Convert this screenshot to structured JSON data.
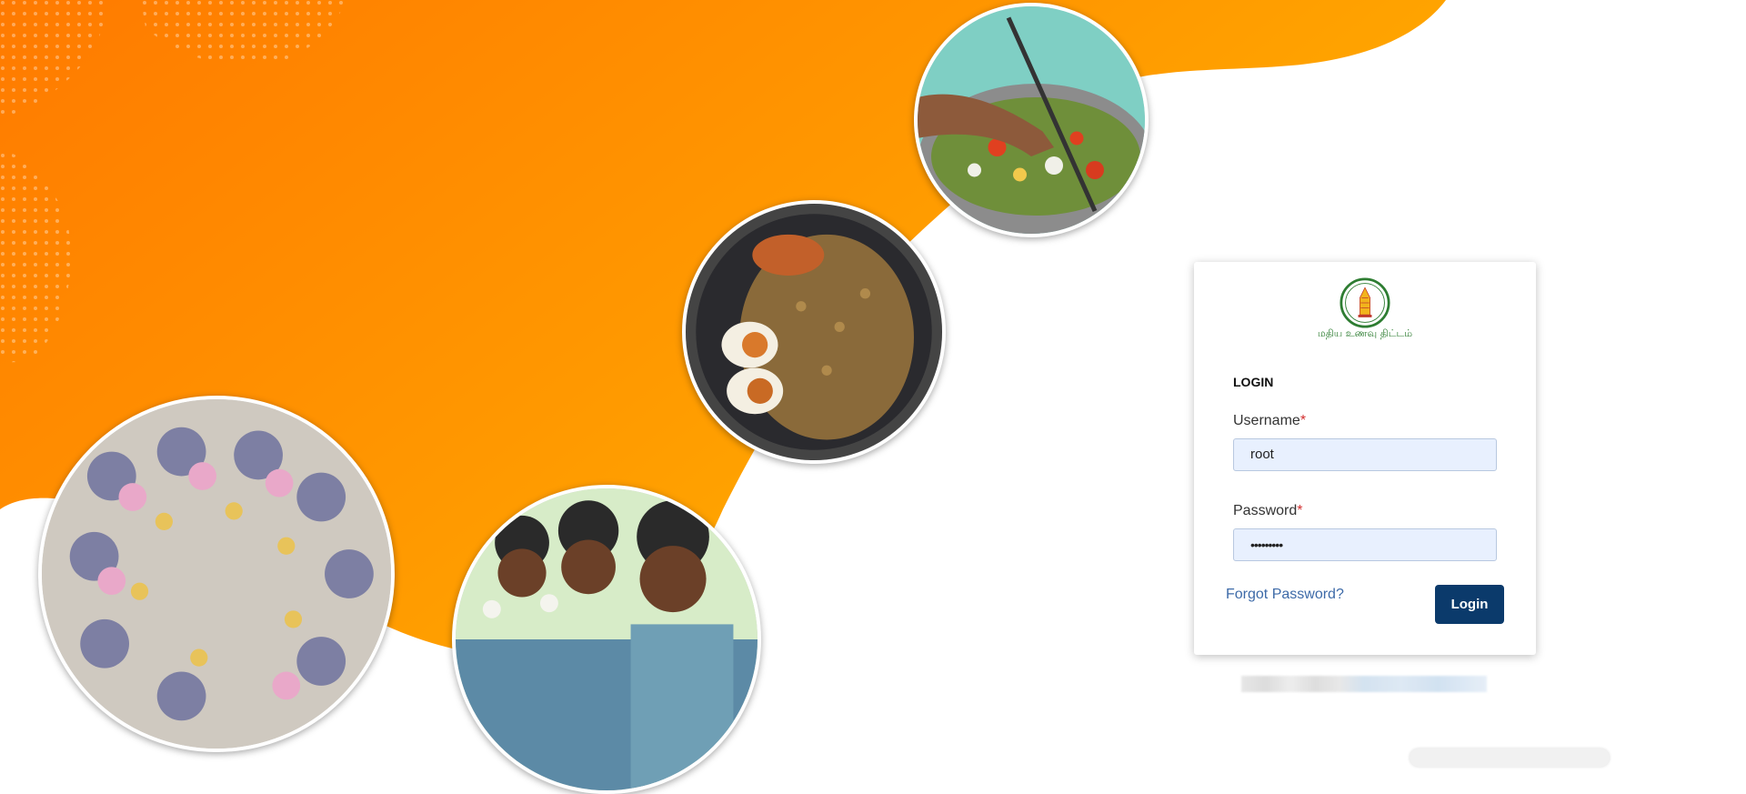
{
  "colors": {
    "orange": "#ff7a00",
    "amber": "#ffb300",
    "button": "#0b3a6b",
    "input_bg": "#e8f0fe",
    "required": "#d32f2f",
    "link": "#3d6aa8"
  },
  "images": {
    "top": "vegetable-cooking-pot",
    "middle": "egg-rice-plate",
    "left": "schoolgirls-eating-circle",
    "bottom": "schoolboys-eating-eggs"
  },
  "logo": {
    "icon": "tamilnadu-emblem",
    "text": "மதிய உணவு திட்டம்"
  },
  "login": {
    "title": "LOGIN",
    "username_label": "Username",
    "username_value": "root",
    "password_label": "Password",
    "password_value": "•••••••••",
    "required_mark": "*",
    "forgot_label": "Forgot Password?",
    "button_label": "Login"
  }
}
